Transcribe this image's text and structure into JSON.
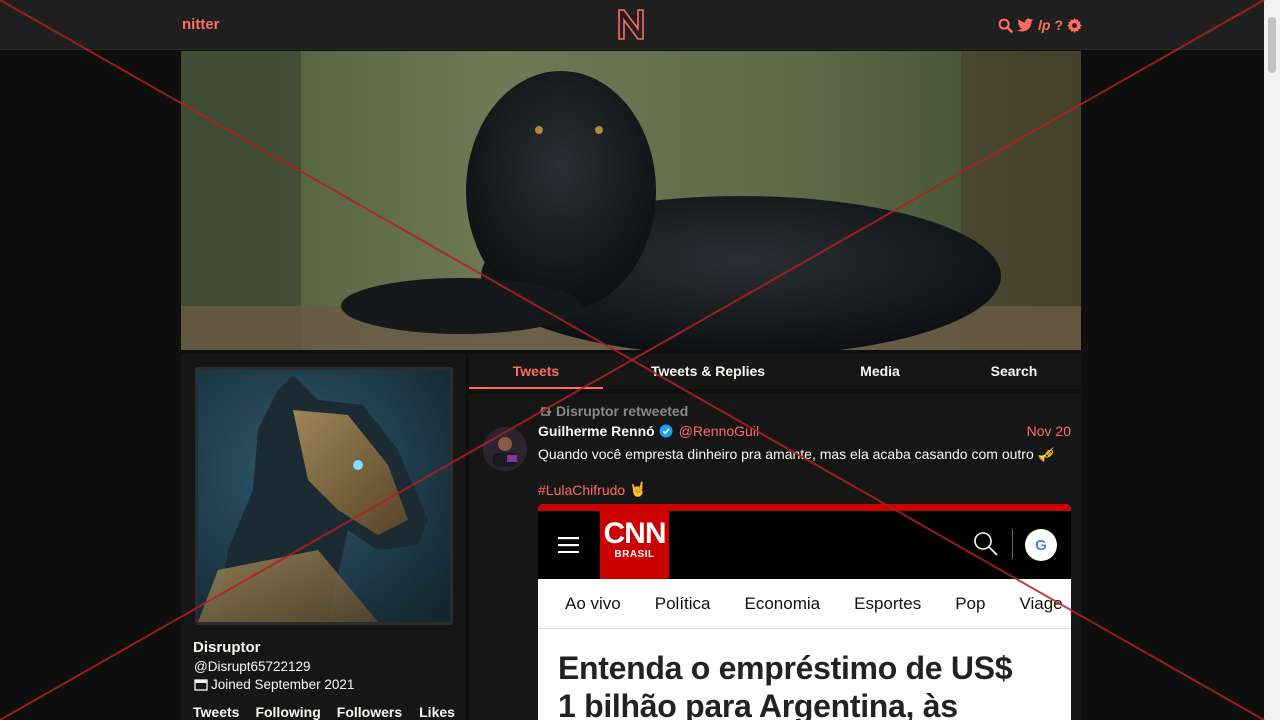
{
  "navbar": {
    "brand": "nitter",
    "logo_letter": "N",
    "icons": [
      "search-icon",
      "twitter-bird-icon",
      "lp-icon",
      "help-icon",
      "gear-icon"
    ],
    "lp_text": "lp",
    "help_text": "?"
  },
  "profile": {
    "fullname": "Disruptor",
    "username": "@Disrupt65722129",
    "joined": "Joined September 2021",
    "stats": [
      "Tweets",
      "Following",
      "Followers",
      "Likes"
    ]
  },
  "tabs": [
    {
      "label": "Tweets",
      "active": true
    },
    {
      "label": "Tweets & Replies",
      "active": false
    },
    {
      "label": "Media",
      "active": false
    },
    {
      "label": "Search",
      "active": false
    }
  ],
  "tweet": {
    "retweet_header": "Disruptor retweeted",
    "author_name": "Guilherme Rennó",
    "author_handle": "@RennoGuil",
    "verified": true,
    "date": "Nov 20",
    "text": "Quando você empresta dinheiro pra amante, mas ela acaba casando com outro 🎺",
    "hashtag": "#LulaChifrudo",
    "hashtag_emoji": "🤘",
    "media": {
      "logo_text": "CNN",
      "logo_sub": "BRASIL",
      "google_text": "G",
      "nav_items": [
        "Ao vivo",
        "Política",
        "Economia",
        "Esportes",
        "Pop",
        "Viage"
      ],
      "headline_line1": "Entenda o empréstimo de US$",
      "headline_line2": "1 bilhão para Argentina, às"
    }
  },
  "colors": {
    "accent": "#ff6c60",
    "background": "#0f0f0f",
    "panel": "#161616",
    "navbar": "#1f1f1f",
    "cnn_red": "#cc0000"
  }
}
